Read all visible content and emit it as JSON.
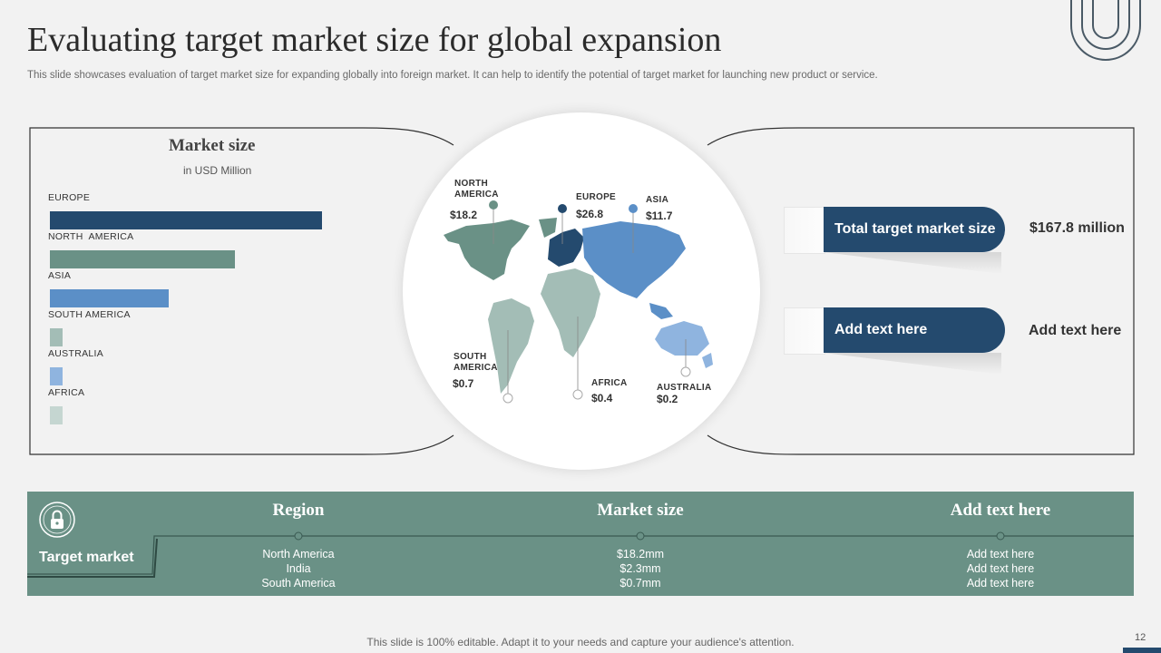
{
  "slide": {
    "title": "Evaluating target market size for global expansion",
    "subtitle": "This slide showcases evaluation of target market size for expanding globally into foreign market. It can help to  identify the potential of target market for launching new product or service.",
    "footer": "This slide is 100% editable. Adapt it to your needs and capture your audience's attention.",
    "page_number": "12"
  },
  "chart_data": {
    "type": "bar",
    "title": "Market size",
    "subtitle": "in USD Million",
    "categories": [
      "EUROPE",
      "NORTH  AMERICA",
      "ASIA",
      "SOUTH AMERICA",
      "AUSTRALIA",
      "AFRICA"
    ],
    "values": [
      26.8,
      18.2,
      11.7,
      0.7,
      0.2,
      0.4
    ],
    "colors": [
      "#244a6e",
      "#6a9186",
      "#5b8fc7",
      "#a3bdb6",
      "#8fb4df",
      "#c5d6d1"
    ]
  },
  "map": {
    "regions": [
      {
        "name": "NORTH\nAMERICA",
        "value": "$18.2"
      },
      {
        "name": "EUROPE",
        "value": "$26.8"
      },
      {
        "name": "ASIA",
        "value": "$11.7"
      },
      {
        "name": "SOUTH\nAMERICA",
        "value": "$0.7"
      },
      {
        "name": "AFRICA",
        "value": "$0.4"
      },
      {
        "name": "AUSTRALIA",
        "value": "$0.2"
      }
    ]
  },
  "summary": {
    "pill1_label": "Total target market size",
    "pill1_value": "$167.8 million",
    "pill2_label": "Add text here",
    "pill2_value": "Add text here"
  },
  "table": {
    "row_label": "Target market",
    "columns": [
      {
        "header": "Region",
        "cells": [
          "North America",
          "India",
          "South America"
        ]
      },
      {
        "header": "Market size",
        "cells": [
          "$18.2mm",
          "$2.3mm",
          "$0.7mm"
        ]
      },
      {
        "header": "Add text here",
        "cells": [
          "Add text here",
          "Add text here",
          "Add text here"
        ]
      }
    ]
  },
  "icons": {
    "table_icon": "lock-icon"
  }
}
